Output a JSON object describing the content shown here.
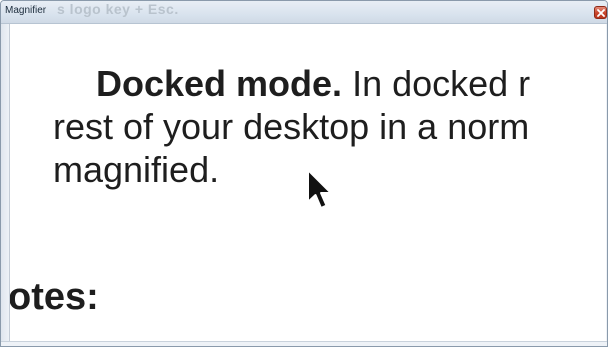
{
  "window": {
    "title": "Magnifier",
    "background_title_text": "s logo key + Esc.",
    "close_icon": "close-icon"
  },
  "content": {
    "line1_bold": "Docked mode.",
    "line1_rest": " In docked r",
    "line2": "rest of your desktop in a norm",
    "line3": "magnified.",
    "heading_partial": "otes:"
  },
  "cursor": {
    "icon": "mouse-pointer-icon"
  },
  "colors": {
    "close_button": "#c9452c",
    "text": "#1e1e1e",
    "titlebar": "#d9e3ee"
  }
}
